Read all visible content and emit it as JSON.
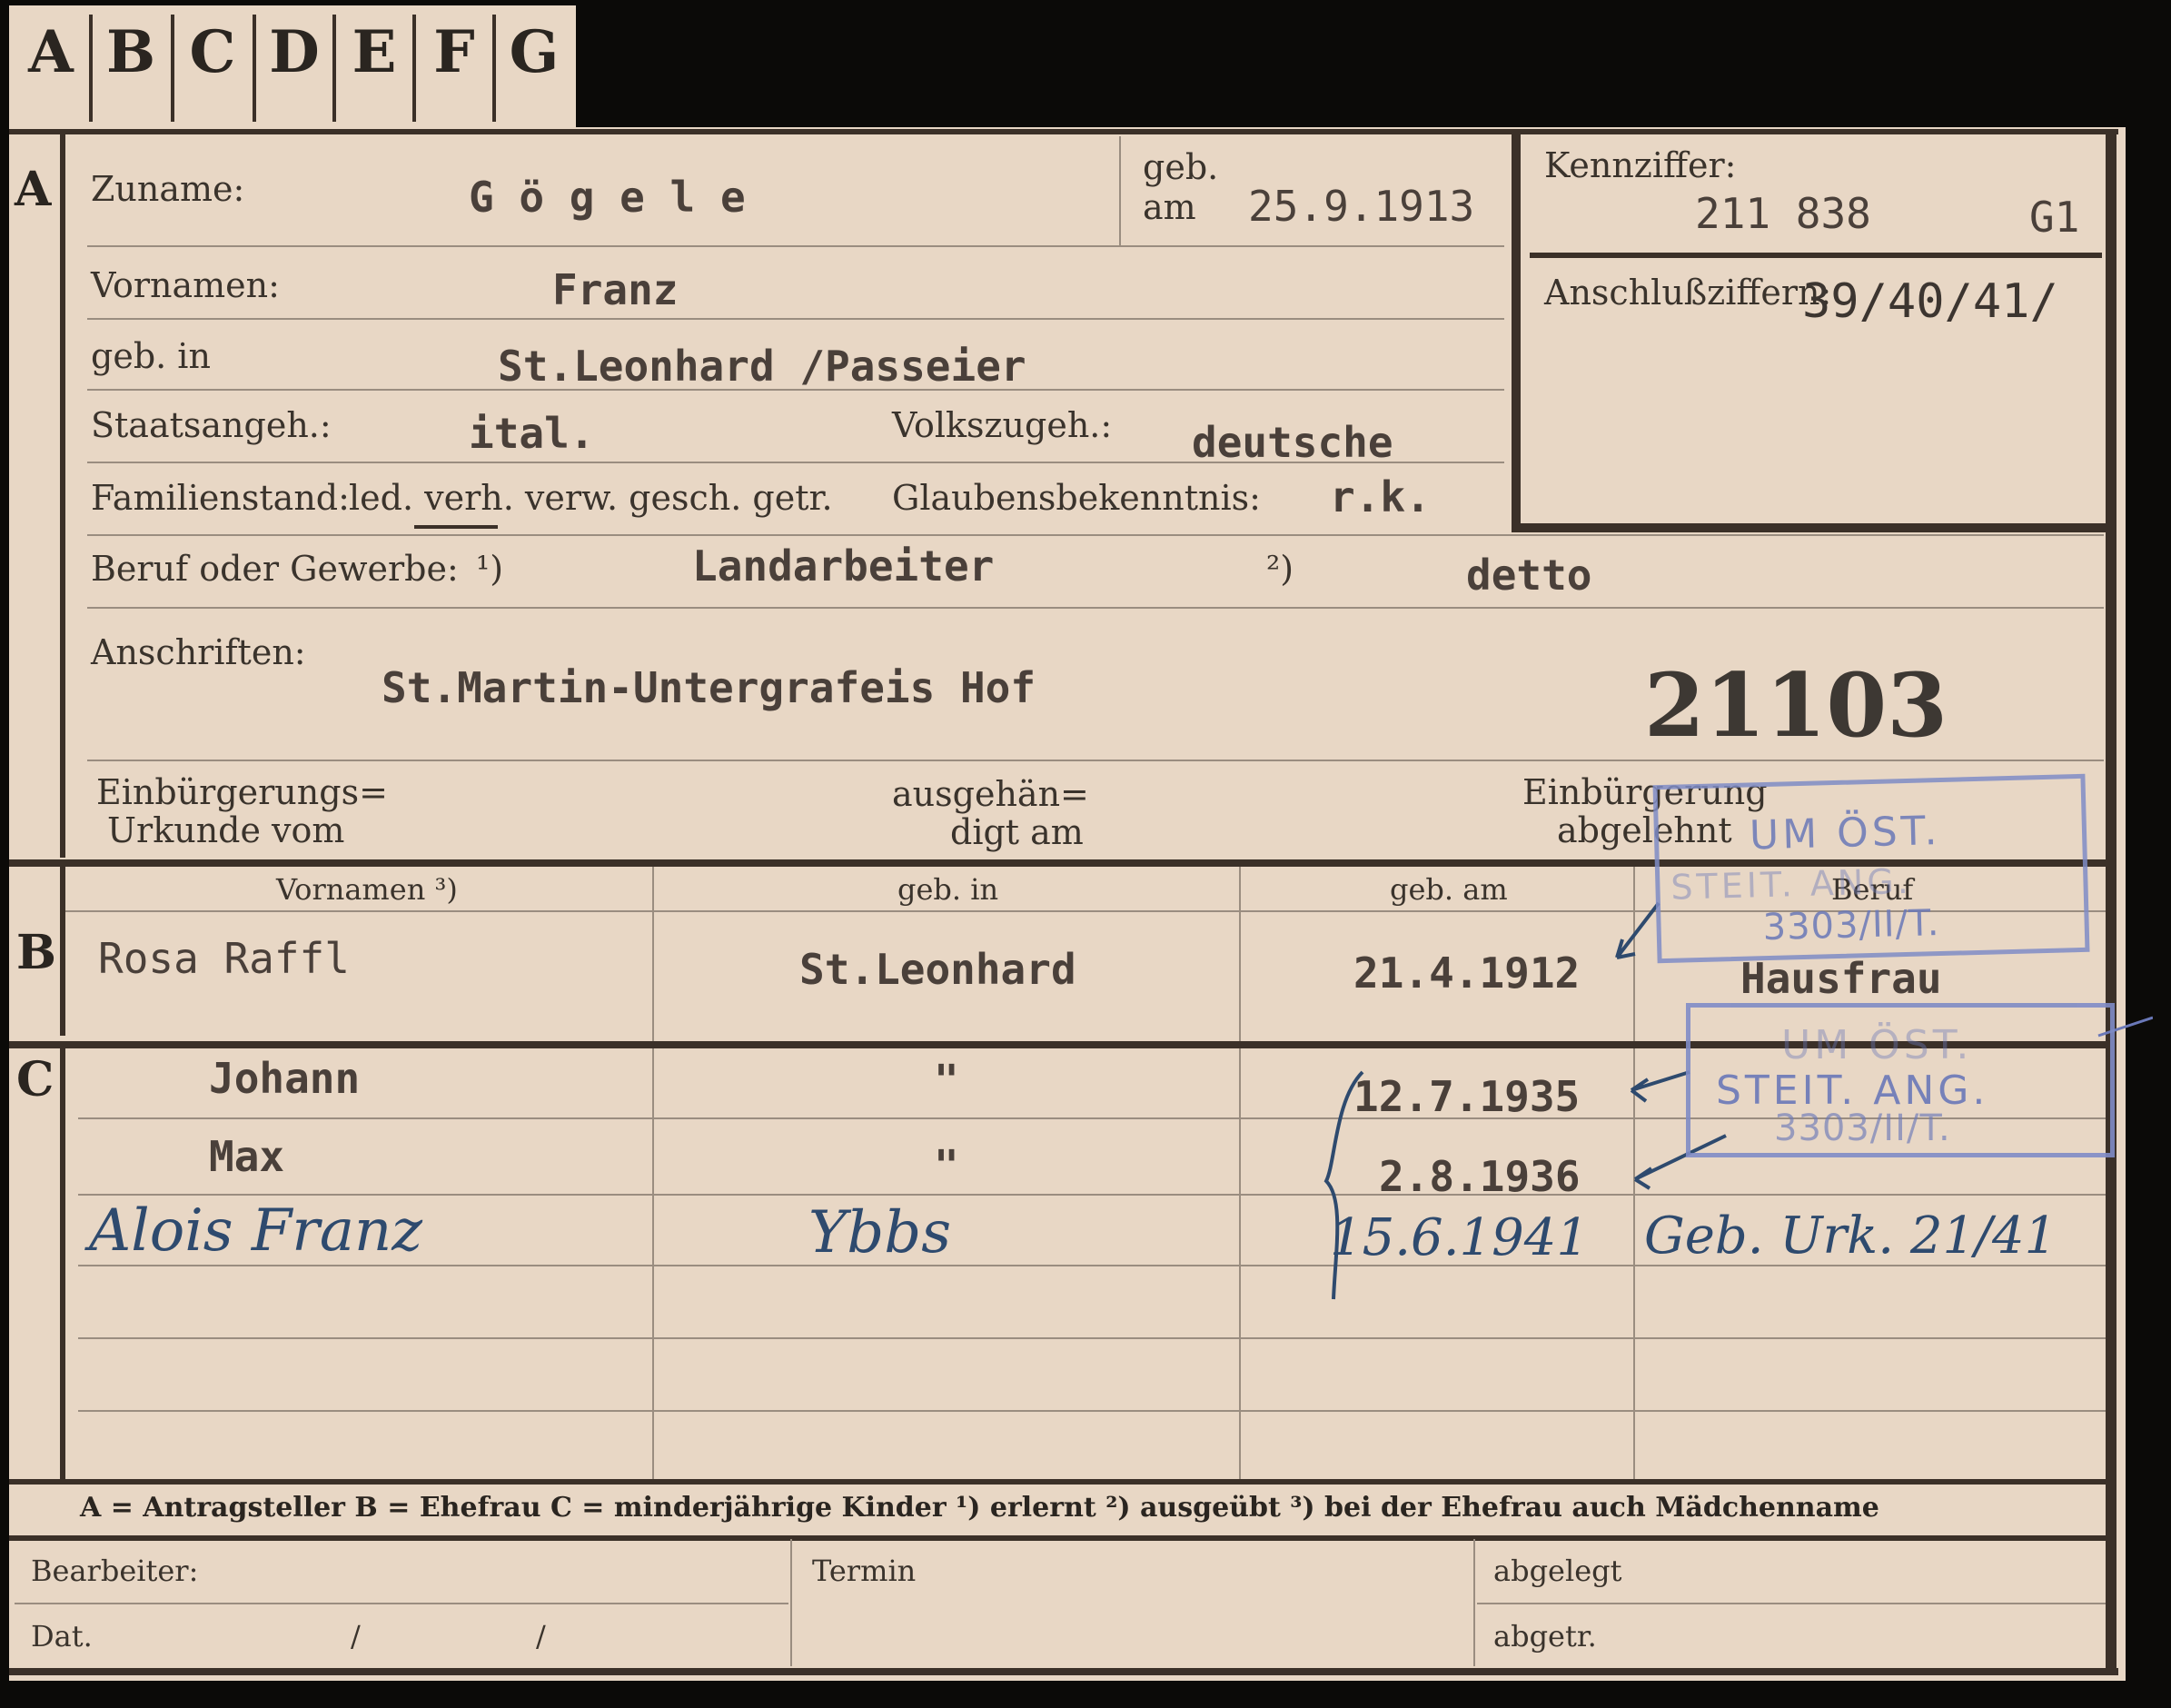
{
  "tabs": [
    "A",
    "B",
    "C",
    "D",
    "E",
    "F",
    "G"
  ],
  "section_letters": {
    "a": "A",
    "b": "B",
    "c": "C"
  },
  "labels": {
    "zuname": "Zuname:",
    "geb_am_1": "geb.",
    "geb_am_2": "am",
    "kennziffer": "Kennziffer:",
    "vornamen": "Vornamen:",
    "anschlussziffern": "Anschlußziffern:",
    "geb_in": "geb. in",
    "staatsangeh": "Staatsangeh.:",
    "volkszugeh": "Volkszugeh.:",
    "familienstand": "Familienstand:",
    "fam_options": "led. verh. verw. gesch. getr.",
    "glaubensbekenntnis": "Glaubensbekenntnis:",
    "beruf": "Beruf oder Gewerbe:",
    "fn1": "¹)",
    "fn2": "²)",
    "anschriften": "Anschriften:",
    "einbuergerung_urkunde_1": "Einbürgerungs=",
    "einbuergerung_urkunde_2": "Urkunde vom",
    "ausgehaendigt_1": "ausgehän=",
    "ausgehaendigt_2": "digt am",
    "einbuergerung_abgelehnt_1": "Einbürgerung",
    "einbuergerung_abgelehnt_2": "abgelehnt"
  },
  "person": {
    "zuname": "G ö g e l e",
    "geb_am": "25.9.1913",
    "kennziffer": "211 838",
    "kennziffer_suffix": "G1",
    "vornamen": "Franz",
    "anschlussziffern": "39/40/41/",
    "geb_in": "St.Leonhard /Passeier",
    "staatsangeh": "ital.",
    "volkszugeh": "deutsche",
    "glaubensbekenntnis": "r.k.",
    "beruf_erlernt": "Landarbeiter",
    "beruf_ausgeuebt": "detto",
    "anschrift": "St.Martin-Untergrafeis Hof",
    "file_number": "21103"
  },
  "table": {
    "headers": [
      "Vornamen ³)",
      "geb. in",
      "geb. am",
      "Beruf"
    ],
    "spouse": {
      "vornamen": "Rosa Raffl",
      "geb_in": "St.Leonhard",
      "geb_am": "21.4.1912",
      "beruf": "Hausfrau"
    },
    "children": [
      {
        "vornamen": "Johann",
        "geb_in": "\"",
        "geb_am": "12.7.1935"
      },
      {
        "vornamen": "Max",
        "geb_in": "\"",
        "geb_am": "2.8.1936"
      },
      {
        "vornamen": "Alois Franz",
        "geb_in": "Ybbs",
        "geb_am": "15.6.1941",
        "note": "Geb. Urk. 21/41"
      }
    ]
  },
  "stamps": {
    "stamp1_line1": "UM ÖST.",
    "stamp1_line2": "STEIT. ANG.",
    "stamp1_number": "3303/II/T.",
    "stamp2_line1": "UM ÖST.",
    "stamp2_line2": "STEIT. ANG.",
    "stamp2_number": "3303/II/T."
  },
  "footer": {
    "legend": "A = Antragsteller   B = Ehefrau   C = minderjährige Kinder   ¹) erlernt   ²) ausgeübt   ³) bei der Ehefrau auch Mädchenname",
    "bearbeiter": "Bearbeiter:",
    "termin": "Termin",
    "abgelegt": "abgelegt",
    "dat": "Dat.",
    "slash1": "/",
    "slash2": "/",
    "abgetr": "abgetr."
  },
  "colors": {
    "paper": "#e8d7c5",
    "ink_stamp": "#6a78b8",
    "ink_hand": "#2e4a6e",
    "rule": "#3b3028"
  }
}
